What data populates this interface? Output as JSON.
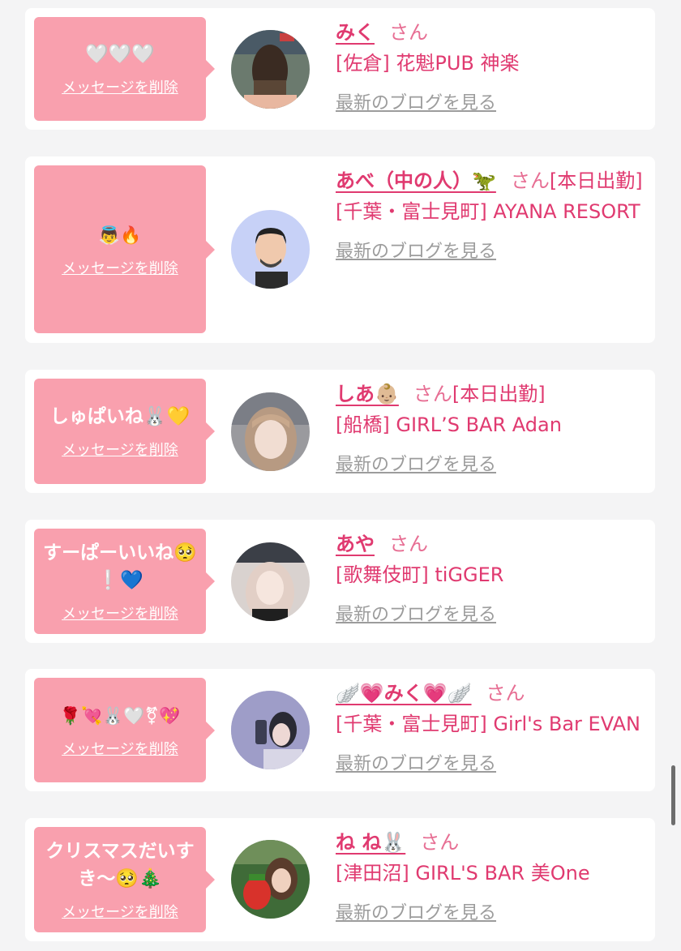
{
  "delete_label": "メッセージを削除",
  "blog_label": "最新のブログを見る",
  "honorific": "さん",
  "entries": [
    {
      "message": "🤍🤍🤍",
      "name": "みく",
      "status": "",
      "shop": "[佐倉] 花魁PUB 神楽"
    },
    {
      "message": "👼🔥",
      "name": "あべ（中の人）🦖",
      "status": "[本日出勤]",
      "shop": "[千葉・富士見町] AYANA RESORT"
    },
    {
      "message": "しゅぱいね🐰💛",
      "name": "しあ👶🏼",
      "status": "[本日出勤]",
      "shop": "[船橋] GIRL’S BAR Adan"
    },
    {
      "message": "すーぱーいいね🥺❕💙",
      "name": "あや",
      "status": "",
      "shop": "[歌舞伎町] tiGGER"
    },
    {
      "message": "🌹💘🐰🤍⚧💖",
      "name": "🪽💗みく💗🪽",
      "status": "",
      "shop": "[千葉・富士見町] Girl's Bar EVAN"
    },
    {
      "message": "クリスマスだいすき〜🥺🎄",
      "name": "ね ね🐰",
      "status": "",
      "shop": "[津田沼] GIRL'S BAR 美One"
    }
  ],
  "colors": {
    "accent": "#e03a70",
    "bubble": "#f9a0ae",
    "background": "#f4f4f5",
    "blog_link": "#9c9c9c"
  }
}
